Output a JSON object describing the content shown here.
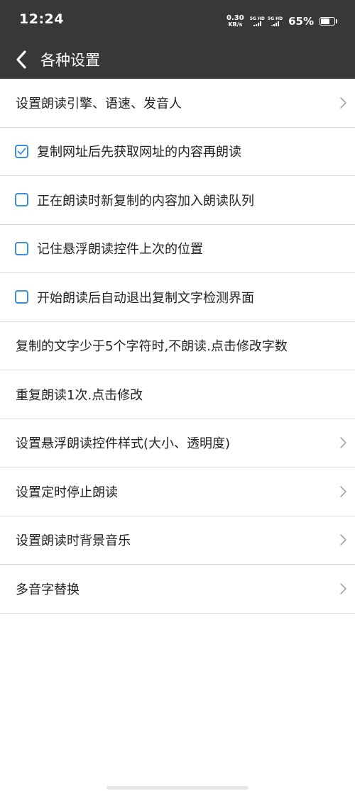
{
  "status_bar": {
    "time": "12:24",
    "net_speed_value": "0.30",
    "net_speed_unit": "KB/s",
    "sim1_label": "5G HD",
    "sim2_label": "5G HD",
    "battery_percent": "65%",
    "battery_level": 0.65
  },
  "header": {
    "title": "各种设置",
    "back_icon": "chevron-left-icon"
  },
  "settings": {
    "items": [
      {
        "type": "nav",
        "label": "设置朗读引擎、语速、发音人",
        "has_chevron": true
      },
      {
        "type": "check",
        "label": "复制网址后先获取网址的内容再朗读",
        "checked": true
      },
      {
        "type": "check",
        "label": "正在朗读时新复制的内容加入朗读队列",
        "checked": false
      },
      {
        "type": "check",
        "label": "记住悬浮朗读控件上次的位置",
        "checked": false
      },
      {
        "type": "check",
        "label": "开始朗读后自动退出复制文字检测界面",
        "checked": false
      },
      {
        "type": "text",
        "label": "复制的文字少于5个字符时,不朗读.点击修改字数",
        "has_chevron": false
      },
      {
        "type": "text",
        "label": "重复朗读1次.点击修改",
        "has_chevron": false
      },
      {
        "type": "nav",
        "label": "设置悬浮朗读控件样式(大小、透明度)",
        "has_chevron": true
      },
      {
        "type": "nav",
        "label": "设置定时停止朗读",
        "has_chevron": true
      },
      {
        "type": "nav",
        "label": "设置朗读时背景音乐",
        "has_chevron": true
      },
      {
        "type": "nav",
        "label": "多音字替换",
        "has_chevron": true
      }
    ]
  },
  "colors": {
    "header_bg": "#383838",
    "checkbox_accent": "#3f8fd8",
    "divider": "#dcdcdc",
    "chevron": "#9a9a9a"
  }
}
